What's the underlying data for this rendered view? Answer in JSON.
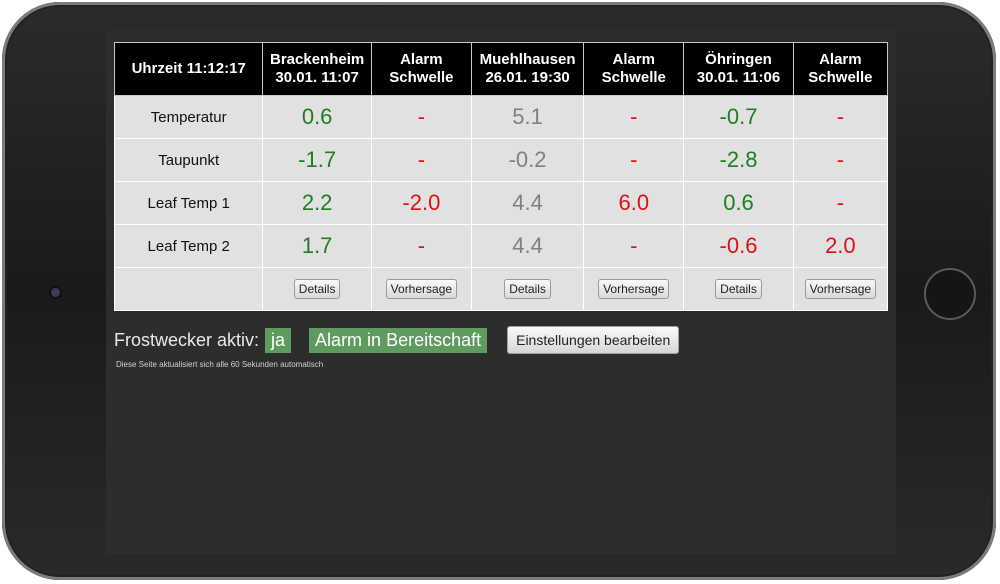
{
  "header": {
    "time": "Uhrzeit 11:12:17",
    "columns": [
      {
        "line1": "Brackenheim",
        "line2": "30.01. 11:07"
      },
      {
        "line1": "Alarm",
        "line2": "Schwelle"
      },
      {
        "line1": "Muehlhausen",
        "line2": "26.01. 19:30"
      },
      {
        "line1": "Alarm",
        "line2": "Schwelle"
      },
      {
        "line1": "Öhringen",
        "line2": "30.01. 11:06"
      },
      {
        "line1": "Alarm",
        "line2": "Schwelle"
      }
    ]
  },
  "rows": [
    {
      "label": "Temperatur",
      "cells": [
        {
          "value": "0.6",
          "color": "green"
        },
        {
          "value": "-",
          "color": "red"
        },
        {
          "value": "5.1",
          "color": "gray"
        },
        {
          "value": "-",
          "color": "red"
        },
        {
          "value": "-0.7",
          "color": "green"
        },
        {
          "value": "-",
          "color": "red"
        }
      ]
    },
    {
      "label": "Taupunkt",
      "cells": [
        {
          "value": "-1.7",
          "color": "green"
        },
        {
          "value": "-",
          "color": "red"
        },
        {
          "value": "-0.2",
          "color": "gray"
        },
        {
          "value": "-",
          "color": "red"
        },
        {
          "value": "-2.8",
          "color": "green"
        },
        {
          "value": "-",
          "color": "red"
        }
      ]
    },
    {
      "label": "Leaf Temp 1",
      "cells": [
        {
          "value": "2.2",
          "color": "green"
        },
        {
          "value": "-2.0",
          "color": "red"
        },
        {
          "value": "4.4",
          "color": "gray"
        },
        {
          "value": "6.0",
          "color": "red"
        },
        {
          "value": "0.6",
          "color": "green"
        },
        {
          "value": "-",
          "color": "red"
        }
      ]
    },
    {
      "label": "Leaf Temp 2",
      "cells": [
        {
          "value": "1.7",
          "color": "green"
        },
        {
          "value": "-",
          "color": "red"
        },
        {
          "value": "4.4",
          "color": "gray"
        },
        {
          "value": "-",
          "color": "red"
        },
        {
          "value": "-0.6",
          "color": "red"
        },
        {
          "value": "2.0",
          "color": "red"
        }
      ]
    }
  ],
  "buttons": {
    "details": "Details",
    "forecast": "Vorhersage"
  },
  "status": {
    "frost_label": "Frostwecker aktiv:",
    "frost_value": "ja",
    "alarm_state": "Alarm in Bereitschaft",
    "edit_button": "Einstellungen bearbeiten",
    "refresh_note": "Diese Seite aktualisiert sich alle 60 Sekunden automatisch"
  },
  "colors": {
    "green": "#1f7e1f",
    "red": "#e01010",
    "gray": "#808080",
    "badge": "#5f9a5f"
  }
}
